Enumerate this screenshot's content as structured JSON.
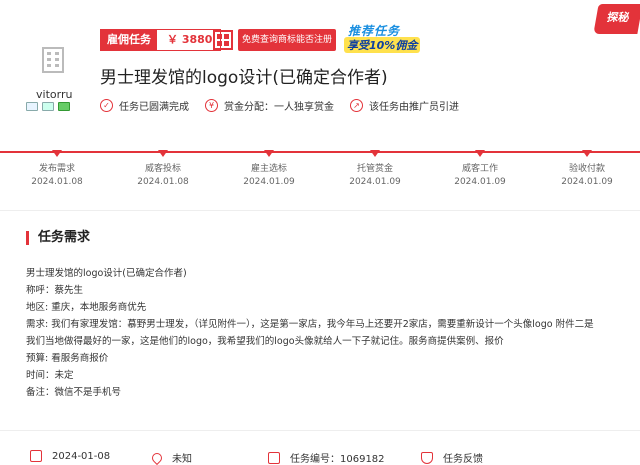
{
  "header": {
    "username": "vitorru",
    "task_tag_label": "雇佣任务",
    "reward": "￥ 3880",
    "query_button": "免费查询商标能否注册",
    "promo_line1": "推荐任务",
    "promo_line2": "享受10%佣金",
    "corner_badge": "探秘",
    "title": "男士理发馆的logo设计(已确定合作者)"
  },
  "badges": [
    {
      "icon": "check-icon",
      "text": "任务已圆满完成"
    },
    {
      "icon": "yuan-icon",
      "text": "赏金分配：一人独享赏金"
    },
    {
      "icon": "share-icon",
      "text": "该任务由推广员引进"
    }
  ],
  "timeline": [
    {
      "name": "发布需求",
      "date": "2024.01.08"
    },
    {
      "name": "威客投标",
      "date": "2024.01.08"
    },
    {
      "name": "雇主选标",
      "date": "2024.01.09"
    },
    {
      "name": "托管赏金",
      "date": "2024.01.09"
    },
    {
      "name": "威客工作",
      "date": "2024.01.09"
    },
    {
      "name": "验收付款",
      "date": "2024.01.09"
    }
  ],
  "section": {
    "title": "任务需求"
  },
  "content": {
    "line1": "男士理发馆的logo设计(已确定合作者)",
    "line2": "称呼：蔡先生",
    "line3": "地区: 重庆，本地服务商优先",
    "line4": "需求: 我们有家理发馆：慕野男士理发，（详见附件一），这是第一家店，我今年马上还要开2家店，需要重新设计一个头像logo  附件二是",
    "line5": "我们当地做得最好的一家，这是他们的logo，我希望我们的logo头像就给人一下子就记住。服务商提供案例、报价",
    "line6": "预算: 看服务商报价",
    "line7": "时间：未定",
    "line8": "备注：微信不是手机号"
  },
  "footer": {
    "date": "2024-01-08",
    "location": "未知",
    "task_number": "任务编号：1069182",
    "feedback": "任务反馈"
  },
  "colors": {
    "accent": "#e3333a",
    "promo_blue": "#1a8fe0",
    "promo_yellow": "#ffe14d"
  }
}
